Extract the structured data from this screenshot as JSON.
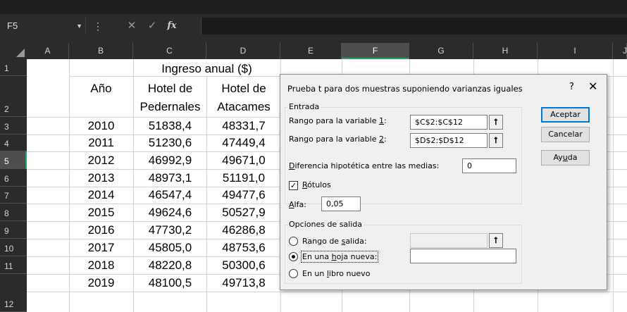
{
  "formula_bar": {
    "name_box": "F5",
    "dropdown_icon": "chevron-down",
    "more_icon": "vertical-ellipsis",
    "cancel_icon": "x",
    "enter_icon": "check",
    "function_icon": "fx"
  },
  "columns": [
    "A",
    "B",
    "C",
    "D",
    "E",
    "F",
    "G",
    "H",
    "I",
    "J"
  ],
  "selected_column": "F",
  "rows": [
    "1",
    "2",
    "3",
    "4",
    "5",
    "6",
    "7",
    "8",
    "9",
    "10",
    "11",
    "12"
  ],
  "selected_row": "5",
  "sheet": {
    "header_merged": "Ingreso anual ($)",
    "year_header": "Año",
    "hotel1_line1": "Hotel de",
    "hotel1_line2": "Pedernales",
    "hotel2_line1": "Hotel de",
    "hotel2_line2": "Atacames",
    "data": [
      {
        "year": "2010",
        "c": "51838,4",
        "d": "48331,7"
      },
      {
        "year": "2011",
        "c": "51230,6",
        "d": "47449,4"
      },
      {
        "year": "2012",
        "c": "46992,9",
        "d": "49671,0"
      },
      {
        "year": "2013",
        "c": "48973,1",
        "d": "51191,0"
      },
      {
        "year": "2014",
        "c": "46547,4",
        "d": "49477,6"
      },
      {
        "year": "2015",
        "c": "49624,6",
        "d": "50527,9"
      },
      {
        "year": "2016",
        "c": "47730,2",
        "d": "46286,8"
      },
      {
        "year": "2017",
        "c": "45805,0",
        "d": "48753,6"
      },
      {
        "year": "2018",
        "c": "48220,8",
        "d": "50300,6"
      },
      {
        "year": "2019",
        "c": "48100,5",
        "d": "49713,8"
      }
    ]
  },
  "dialog": {
    "title": "Prueba t para dos muestras suponiendo varianzas iguales",
    "help": "?",
    "close": "✕",
    "input_group": "Entrada",
    "var1_pre": "Rango para la variable ",
    "var1_key": "1",
    "var1_post": ":",
    "var1_value": "$C$2:$C$12",
    "var2_pre": "Rango para la variable ",
    "var2_key": "2",
    "var2_post": ":",
    "var2_value": "$D$2:$D$12",
    "diff_key": "D",
    "diff_rest": "iferencia hipotética entre las medias:",
    "diff_value": "0",
    "labels_key": "R",
    "labels_rest": "ótulos",
    "labels_checked": true,
    "alpha_key": "A",
    "alpha_rest": "lfa:",
    "alpha_value": "0,05",
    "output_group": "Opciones de salida",
    "opt_range_pre": "Rango de ",
    "opt_range_key": "s",
    "opt_range_post": "alida:",
    "opt_range_value": "",
    "opt_newsheet_pre": "En una ",
    "opt_newsheet_key": "h",
    "opt_newsheet_post": "oja nueva:",
    "opt_newsheet_value": "",
    "opt_newbook_pre": "En un ",
    "opt_newbook_key": "l",
    "opt_newbook_post": "ibro nuevo",
    "selected_option": "new_sheet",
    "ok": "Aceptar",
    "cancel": "Cancelar",
    "help_btn_pre": "Ay",
    "help_btn_key": "u",
    "help_btn_post": "da",
    "ref_icon": "range-selector-arrow"
  }
}
